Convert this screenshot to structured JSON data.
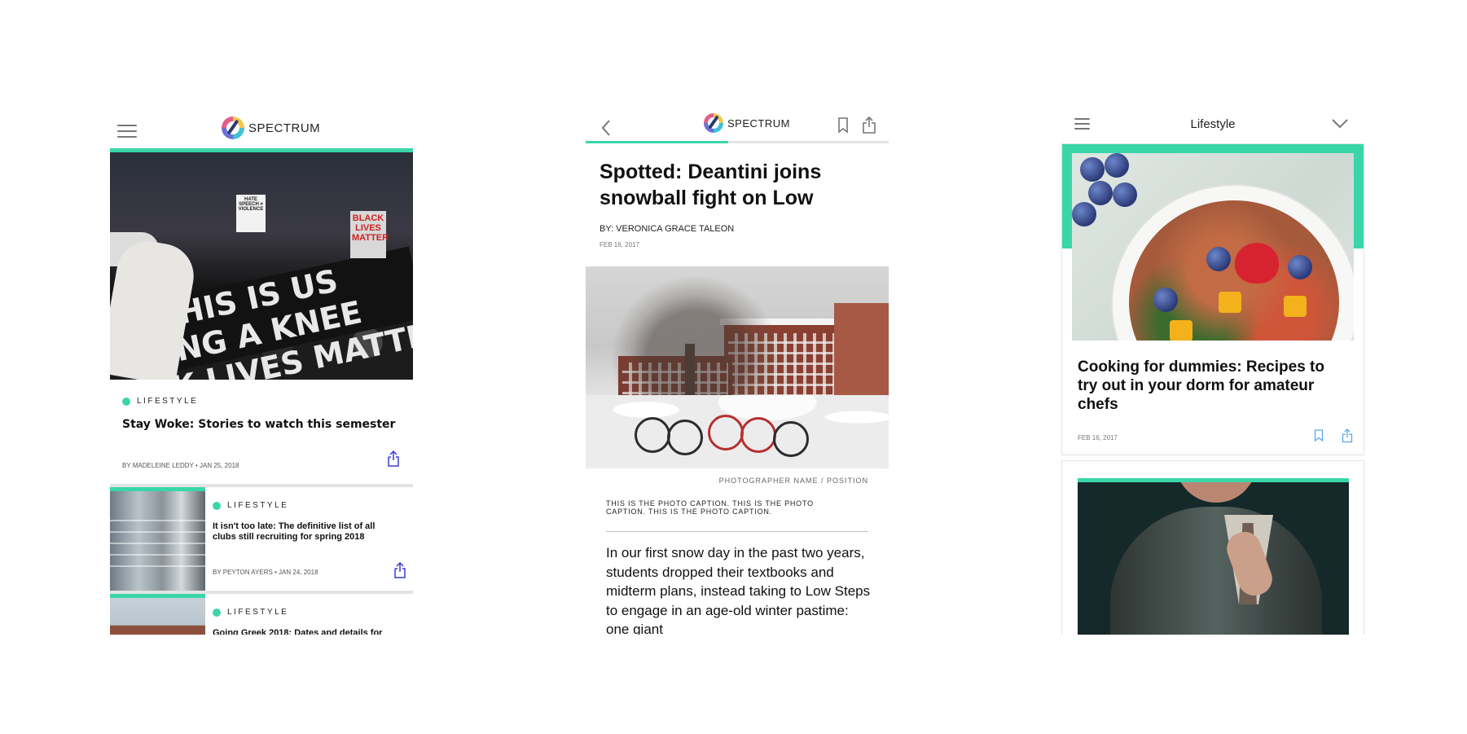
{
  "screen1": {
    "brand": "SPECTRUM",
    "lead": {
      "category": "LIFESTYLE",
      "title": "Stay Woke: Stories to watch this semester",
      "byline": "BY MADELEINE LEDDY • JAN 25, 2018",
      "photo_signs": [
        "HATE SPEECH ≠ VIOLENCE",
        "BLACK LIVES MATTER"
      ],
      "photo_banner": "THIS IS US\nING A KNEE\nK LIVES MATTE"
    },
    "rows": [
      {
        "category": "LIFESTYLE",
        "title": "It isn't too late: The definitive list of all clubs still recruiting for spring 2018",
        "byline": "BY PEYTON AYERS • JAN 24, 2018"
      },
      {
        "category": "LIFESTYLE",
        "title": "Going Greek 2018: Dates and details for",
        "byline": ""
      }
    ],
    "colors": {
      "accent": "#3ad6a9",
      "icon_blue": "#3b3bd6"
    }
  },
  "screen2": {
    "brand": "SPECTRUM",
    "reading_progress": 0.47,
    "title": "Spotted: Deantini joins snowball fight on Low",
    "byline": "BY: VERONICA GRACE TALEON",
    "date": "FEB 16, 2017",
    "photo_credit": "PHOTOGRAPHER NAME / POSITION",
    "caption": "THIS IS THE PHOTO CAPTION. THIS IS THE PHOTO CAPTION. THIS IS THE PHOTO CAPTION.",
    "body": "In our first snow day in the past two years, students dropped their textbooks and midterm plans, instead taking to Low Steps to engage in an age-old winter pastime: one giant"
  },
  "screen3": {
    "section": "Lifestyle",
    "card": {
      "title": "Cooking for dummies: Recipes to try out in your dorm for amateur chefs",
      "date": "FEB 16, 2017"
    },
    "icons": {
      "menu": "hamburger-icon",
      "dropdown": "chevron-down-icon",
      "bookmark": "bookmark-icon",
      "share": "share-icon"
    }
  }
}
